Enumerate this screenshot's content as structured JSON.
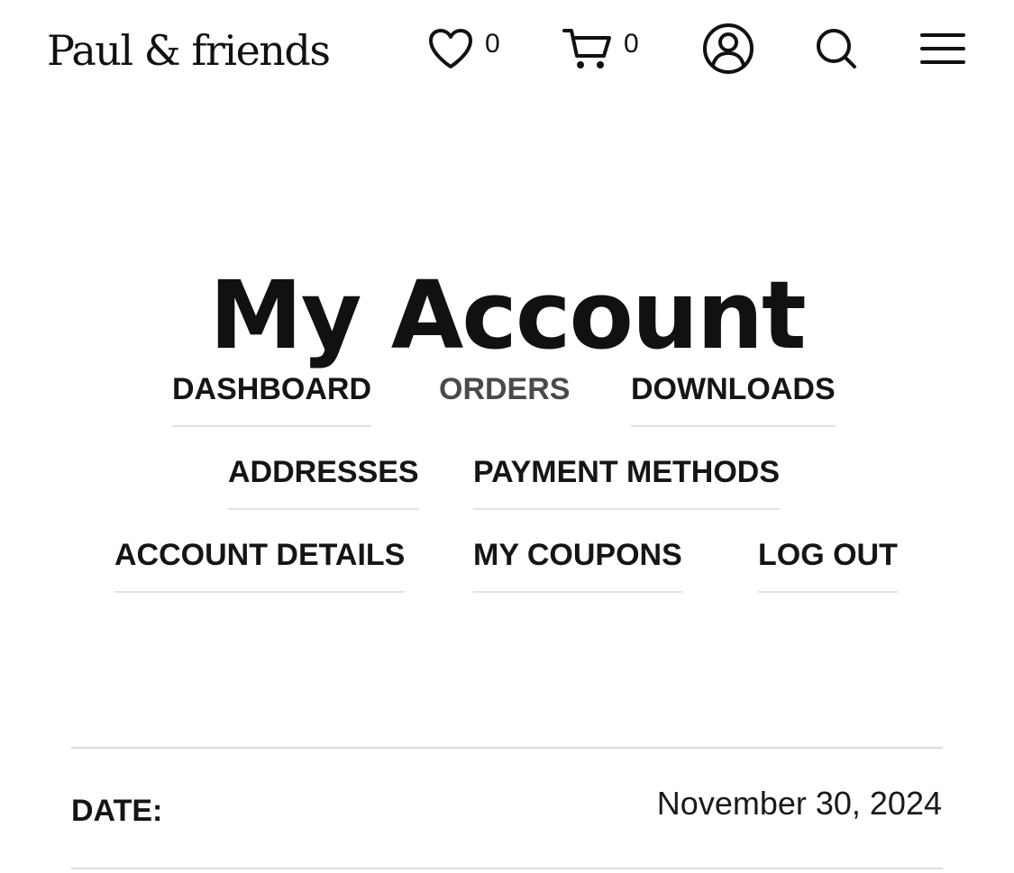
{
  "header": {
    "brand": "Paul & friends",
    "wishlist_count": "0",
    "cart_count": "0",
    "icons": [
      "heart-icon",
      "cart-icon",
      "user-icon",
      "search-icon",
      "menu-icon"
    ]
  },
  "main": {
    "title": "My Account",
    "nav": {
      "dashboard": "DASHBOARD",
      "orders": "ORDERS",
      "downloads": "DOWNLOADS",
      "addresses": "ADDRESSES",
      "payment_methods": "PAYMENT METHODS",
      "account_details": "ACCOUNT DETAILS",
      "my_coupons": "MY COUPONS",
      "log_out": "LOG OUT"
    },
    "active_tab": "ORDERS"
  },
  "order": {
    "date_label": "DATE:",
    "date_value": "November 30, 2024"
  }
}
